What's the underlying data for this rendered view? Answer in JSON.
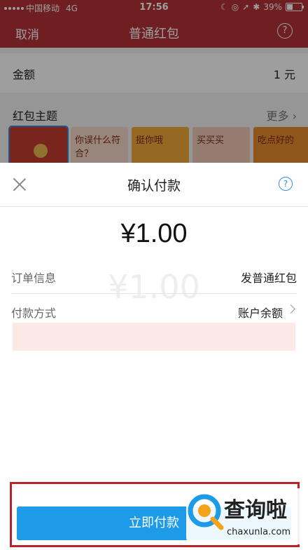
{
  "status_bar": {
    "carrier": "中国移动",
    "network": "4G",
    "time": "17:56",
    "battery": "39%",
    "battery_level": 0.39
  },
  "nav": {
    "cancel": "取消",
    "title": "普通红包",
    "help": "?"
  },
  "amount": {
    "label": "金额",
    "value": "1 元"
  },
  "theme": {
    "label": "红包主题",
    "more": "更多",
    "thumbs": [
      "",
      "你误什么符合？",
      "挺你哦",
      "买买买",
      "吃点好的"
    ]
  },
  "sheet": {
    "title": "确认付款",
    "help": "?",
    "price": "¥1.00",
    "order_label": "订单信息",
    "order_value": "发普通红包",
    "method_label": "付款方式",
    "method_value": "账户余额",
    "pay_button": "立即付款"
  },
  "watermark": {
    "text": "查询啦",
    "domain": "chaxunla.com"
  },
  "colors": {
    "nav_red": "#b33236",
    "pay_blue": "#1e9be8",
    "highlight_red": "#b8232a"
  }
}
